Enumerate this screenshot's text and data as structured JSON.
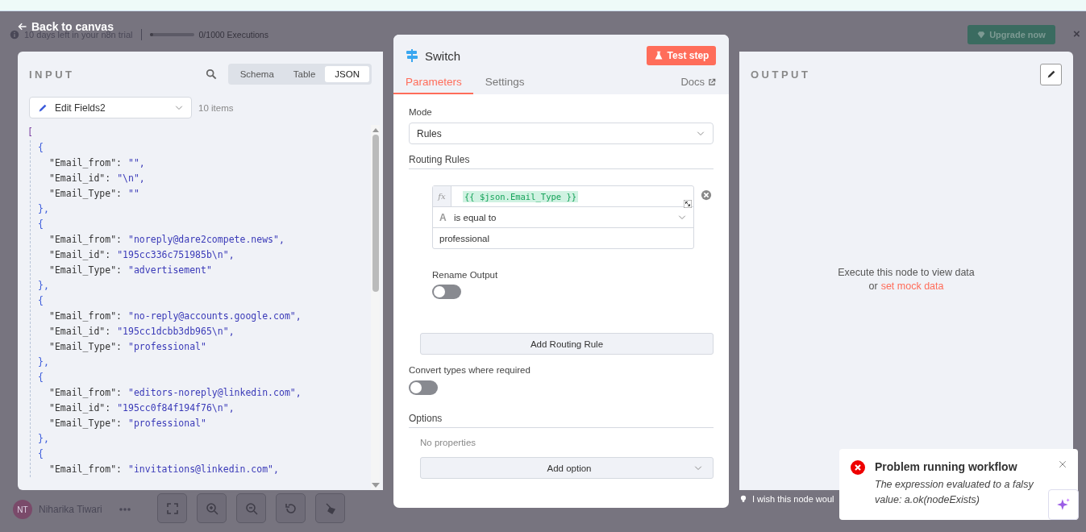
{
  "back_link": "Back to canvas",
  "trial_banner": {
    "text": "10 days left in your n8n trial",
    "executions": "0/1000 Executions",
    "executions_bar": {
      "level": 0
    },
    "upgrade_button": "Upgrade now",
    "close_glyph": "×"
  },
  "user": {
    "initials": "NT",
    "name": "Niharika Tiwari"
  },
  "node_hint": "I wish this node woul",
  "input_panel": {
    "title": "INPUT",
    "view_tabs": [
      {
        "label": "Schema",
        "selected": false
      },
      {
        "label": "Table",
        "selected": false
      },
      {
        "label": "JSON",
        "selected": true
      }
    ],
    "source": "Edit Fields2",
    "item_count": "10 items",
    "json_open": "[",
    "json_items": [
      {
        "open": "{",
        "close": "},",
        "pairs": [
          {
            "key": "\"Email_from\":",
            "value": "\"\","
          },
          {
            "key": "\"Email_id\":",
            "value": "\"\\n\","
          },
          {
            "key": "\"Email_Type\":",
            "value": "\"\""
          }
        ]
      },
      {
        "open": "{",
        "close": "},",
        "pairs": [
          {
            "key": "\"Email_from\":",
            "value": "\"noreply@dare2compete.news\","
          },
          {
            "key": "\"Email_id\":",
            "value": "\"195cc336c751985b\\n\","
          },
          {
            "key": "\"Email_Type\":",
            "value": "\"advertisement\""
          }
        ]
      },
      {
        "open": "{",
        "close": "},",
        "pairs": [
          {
            "key": "\"Email_from\":",
            "value": "\"no-reply@accounts.google.com\","
          },
          {
            "key": "\"Email_id\":",
            "value": "\"195cc1dcbb3db965\\n\","
          },
          {
            "key": "\"Email_Type\":",
            "value": "\"professional\""
          }
        ]
      },
      {
        "open": "{",
        "close": "},",
        "pairs": [
          {
            "key": "\"Email_from\":",
            "value": "\"editors-noreply@linkedin.com\","
          },
          {
            "key": "\"Email_id\":",
            "value": "\"195cc0f84f194f76\\n\","
          },
          {
            "key": "\"Email_Type\":",
            "value": "\"professional\""
          }
        ]
      },
      {
        "open": "{",
        "pairs": [
          {
            "key": "\"Email_from\":",
            "value": "\"invitations@linkedin.com\","
          }
        ]
      }
    ]
  },
  "node_panel": {
    "title": "Switch",
    "test_button": "Test step",
    "tabs": [
      {
        "label": "Parameters",
        "selected": true
      },
      {
        "label": "Settings",
        "selected": false
      }
    ],
    "docs_link": "Docs",
    "mode": {
      "label": "Mode",
      "value": "Rules"
    },
    "routing_rules": {
      "label": "Routing Rules",
      "rules": [
        {
          "expression_prefix": "fx",
          "expression": "{{ $json.Email_Type }}",
          "operator_type": "A",
          "operator": "is equal to",
          "value": "professional",
          "rename_output": {
            "label": "Rename Output",
            "on": false
          }
        }
      ],
      "add_button": "Add Routing Rule"
    },
    "convert_types": {
      "label": "Convert types where required",
      "on": false
    },
    "options": {
      "label": "Options",
      "empty_text": "No properties",
      "add_button": "Add option"
    }
  },
  "output_panel": {
    "title": "OUTPUT",
    "message": "Execute this node to view data",
    "link_prefix": "or",
    "link": "set mock data"
  },
  "toast": {
    "title": "Problem running workflow",
    "message": "The expression evaluated to a falsy value: a.ok(nodeExists)"
  }
}
